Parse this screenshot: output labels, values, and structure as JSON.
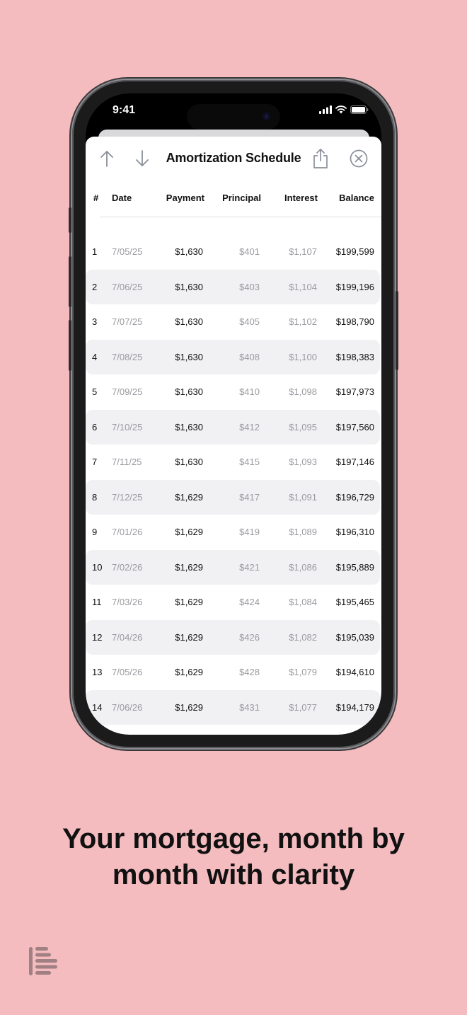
{
  "status_bar": {
    "time": "9:41"
  },
  "sheet": {
    "title": "Amortization Schedule",
    "icons": [
      "arrow-up-icon",
      "arrow-down-icon",
      "share-icon",
      "close-icon"
    ]
  },
  "table": {
    "headers": {
      "num": "#",
      "date": "Date",
      "payment": "Payment",
      "principal": "Principal",
      "interest": "Interest",
      "balance": "Balance"
    },
    "rows": [
      {
        "num": "1",
        "date": "7/05/25",
        "payment": "$1,630",
        "principal": "$401",
        "interest": "$1,107",
        "balance": "$199,599"
      },
      {
        "num": "2",
        "date": "7/06/25",
        "payment": "$1,630",
        "principal": "$403",
        "interest": "$1,104",
        "balance": "$199,196"
      },
      {
        "num": "3",
        "date": "7/07/25",
        "payment": "$1,630",
        "principal": "$405",
        "interest": "$1,102",
        "balance": "$198,790"
      },
      {
        "num": "4",
        "date": "7/08/25",
        "payment": "$1,630",
        "principal": "$408",
        "interest": "$1,100",
        "balance": "$198,383"
      },
      {
        "num": "5",
        "date": "7/09/25",
        "payment": "$1,630",
        "principal": "$410",
        "interest": "$1,098",
        "balance": "$197,973"
      },
      {
        "num": "6",
        "date": "7/10/25",
        "payment": "$1,630",
        "principal": "$412",
        "interest": "$1,095",
        "balance": "$197,560"
      },
      {
        "num": "7",
        "date": "7/11/25",
        "payment": "$1,630",
        "principal": "$415",
        "interest": "$1,093",
        "balance": "$197,146"
      },
      {
        "num": "8",
        "date": "7/12/25",
        "payment": "$1,629",
        "principal": "$417",
        "interest": "$1,091",
        "balance": "$196,729"
      },
      {
        "num": "9",
        "date": "7/01/26",
        "payment": "$1,629",
        "principal": "$419",
        "interest": "$1,089",
        "balance": "$196,310"
      },
      {
        "num": "10",
        "date": "7/02/26",
        "payment": "$1,629",
        "principal": "$421",
        "interest": "$1,086",
        "balance": "$195,889"
      },
      {
        "num": "11",
        "date": "7/03/26",
        "payment": "$1,629",
        "principal": "$424",
        "interest": "$1,084",
        "balance": "$195,465"
      },
      {
        "num": "12",
        "date": "7/04/26",
        "payment": "$1,629",
        "principal": "$426",
        "interest": "$1,082",
        "balance": "$195,039"
      },
      {
        "num": "13",
        "date": "7/05/26",
        "payment": "$1,629",
        "principal": "$428",
        "interest": "$1,079",
        "balance": "$194,610"
      },
      {
        "num": "14",
        "date": "7/06/26",
        "payment": "$1,629",
        "principal": "$431",
        "interest": "$1,077",
        "balance": "$194,179"
      }
    ]
  },
  "caption": {
    "line1": "Your mortgage, month by",
    "line2": "month with clarity"
  },
  "colors": {
    "background": "#f4bcbf",
    "row_alt": "#f1f1f4",
    "muted_text": "#9a9aa0",
    "icon": "#8a8f99"
  }
}
